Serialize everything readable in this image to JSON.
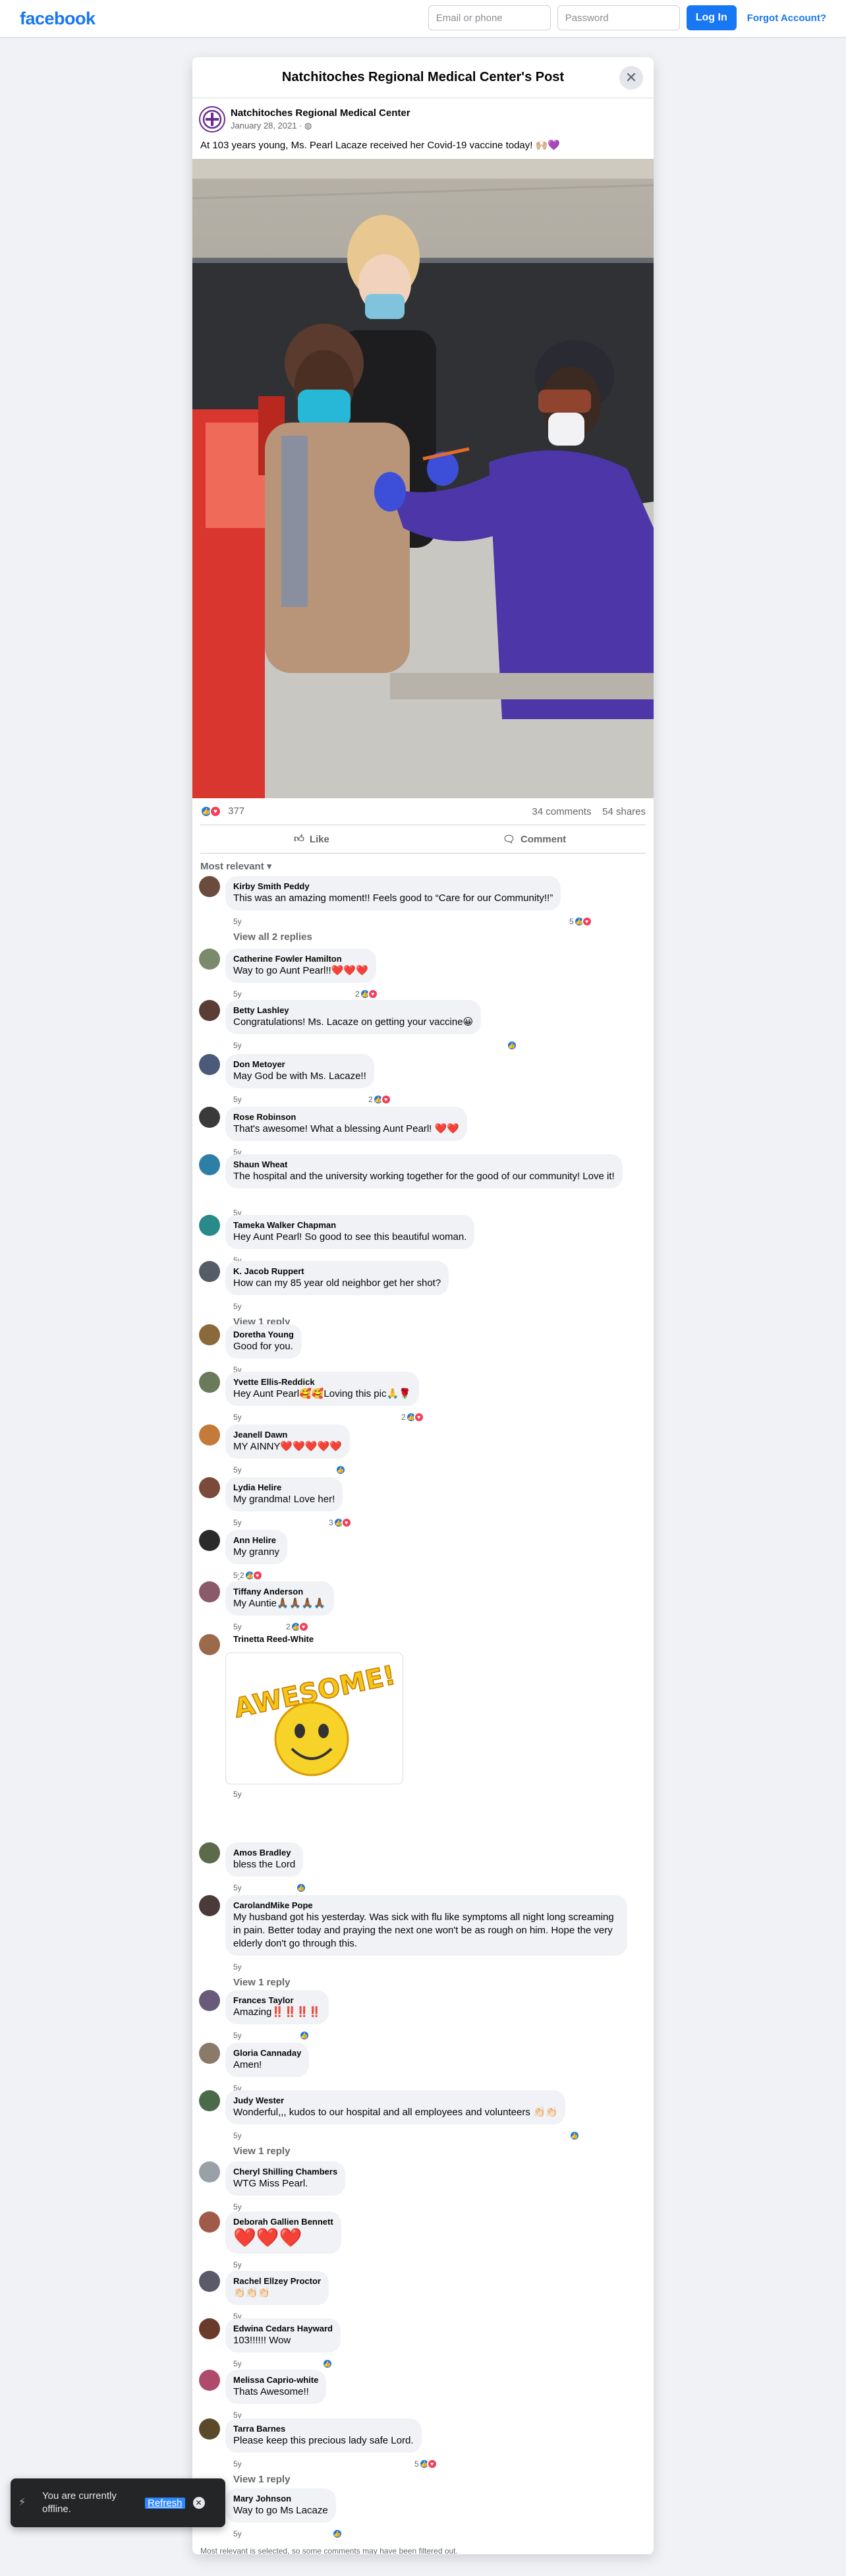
{
  "header": {
    "logo": "facebook",
    "email_placeholder": "Email or phone",
    "password_placeholder": "Password",
    "login_label": "Log In",
    "forgot_label": "Forgot Account?"
  },
  "modal": {
    "title": "Natchitoches Regional Medical Center's Post"
  },
  "post": {
    "page_name": "Natchitoches Regional Medical Center",
    "date": "January 28, 2021 · ",
    "text": "At 103 years young, Ms. Pearl Lacaze received her Covid-19 vaccine today! 🙌🏼💜",
    "reactions_count": "377",
    "comments_count": "34 comments",
    "shares_count": "54 shares"
  },
  "actions": {
    "like": "Like",
    "comment": "Comment"
  },
  "sort_label": "Most relevant",
  "comments": [
    {
      "name": "Kirby Smith Peddy",
      "text": "This was an amazing moment!! Feels good to “Care for our Community!!”",
      "time": "5y",
      "reactions": "5",
      "replies": "View all 2 replies",
      "avatar_color": "#6b4b3e"
    },
    {
      "name": "Catherine Fowler Hamilton",
      "text": "Way to go Aunt Pearl!!❤️❤️❤️",
      "time": "5y",
      "reactions": "2",
      "avatar_color": "#7a8a6a"
    },
    {
      "name": "Betty Lashley",
      "text": "Congratulations! Ms. Lacaze on getting your vaccine😀",
      "time": "5y",
      "reactions": "",
      "avatar_color": "#5a3e36"
    },
    {
      "name": "Don Metoyer",
      "text": "May God be with Ms. Lacaze!!",
      "time": "5y",
      "reactions": "2",
      "avatar_color": "#4a5a78"
    },
    {
      "name": "Rose Robinson",
      "text": "That's awesome! What a blessing Aunt Pearl! ❤️❤️",
      "time": "5y",
      "reactions": "",
      "avatar_color": "#3a3a3a"
    },
    {
      "name": "Shaun Wheat",
      "text": "The hospital and the university working together for the good of our community! Love it!",
      "time": "5y",
      "reactions": "",
      "avatar_color": "#2d7fa8"
    },
    {
      "name": "Tameka Walker Chapman",
      "text": "Hey Aunt Pearl! So good to see this beautiful woman.",
      "time": "5y",
      "reactions": "",
      "avatar_color": "#2a8a8a"
    },
    {
      "name": "K. Jacob Ruppert",
      "text": "How can my 85 year old neighbor get her shot?",
      "time": "5y",
      "reactions": "",
      "replies": "View 1 reply",
      "avatar_color": "#555c66"
    },
    {
      "name": "Doretha Young",
      "text": "Good for you.",
      "time": "5y",
      "reactions": "",
      "avatar_color": "#8a6a3a"
    },
    {
      "name": "Yvette Ellis-Reddick",
      "text": "Hey Aunt Pearl🥰🥰Loving this pic🙏🌹",
      "time": "5y",
      "reactions": "2",
      "avatar_color": "#6a7a5a"
    },
    {
      "name": "Jeanell Dawn",
      "text": "MY AINNY❤️❤️❤️❤️❤️",
      "time": "5y",
      "reactions": "",
      "avatar_color": "#c47a3a"
    },
    {
      "name": "Lydia Helire",
      "text": "My grandma! Love her!",
      "time": "5y",
      "reactions": "3",
      "avatar_color": "#7a4a3a"
    },
    {
      "name": "Ann Helire",
      "text": "My granny",
      "time": "5y",
      "reactions": "2",
      "avatar_color": "#2a2a2a"
    },
    {
      "name": "Tiffany Anderson",
      "text": "My Auntie🙏🏾🙏🏾🙏🏾🙏🏾",
      "time": "5y",
      "reactions": "2",
      "avatar_color": "#8a5a6a"
    },
    {
      "name": "Trinetta Reed-White",
      "text": "",
      "time": "5y",
      "reactions": "",
      "sticker": "AWESOME!",
      "avatar_color": "#9a6a4a"
    },
    {
      "name": "Amos Bradley",
      "text": "bless the Lord",
      "time": "5y",
      "reactions": "",
      "avatar_color": "#5a6a4a"
    },
    {
      "name": "CarolandMike Pope",
      "text": "My husband got his yesterday. Was sick with flu like symptoms all night long screaming in pain. Better today and praying the next one won't be as rough on him. Hope the very elderly don't go through this.",
      "time": "5y",
      "reactions": "",
      "replies": "View 1 reply",
      "avatar_color": "#4a3a3a"
    },
    {
      "name": "Frances Taylor",
      "text": "Amazing‼️‼️‼️‼️",
      "time": "5y",
      "reactions": "",
      "avatar_color": "#6a5a7a"
    },
    {
      "name": "Gloria Cannaday",
      "text": "Amen!",
      "time": "5y",
      "reactions": "",
      "avatar_color": "#8a7a6a"
    },
    {
      "name": "Judy Wester",
      "text": "Wonderful,,, kudos to our hospital and all employees and volunteers 👏🏻👏🏻",
      "time": "5y",
      "reactions": "",
      "replies": "View 1 reply",
      "avatar_color": "#4a6a4a"
    },
    {
      "name": "Cheryl Shilling Chambers",
      "text": "WTG Miss Pearl.",
      "time": "5y",
      "reactions": "",
      "avatar_color": "#9aa0a8"
    },
    {
      "name": "Deborah Gallien Bennett",
      "text": "❤️❤️❤️",
      "time": "5y",
      "reactions": "",
      "avatar_color": "#a05a4a"
    },
    {
      "name": "Rachel Ellzey Proctor",
      "text": "👏🏻👏🏻👏🏻",
      "time": "5y",
      "reactions": "",
      "avatar_color": "#5a5a6a"
    },
    {
      "name": "Edwina Cedars Hayward",
      "text": "103!!!!!! Wow",
      "time": "5y",
      "reactions": "",
      "avatar_color": "#6a3a2a"
    },
    {
      "name": "Melissa Caprio-white",
      "text": "Thats Awesome!!",
      "time": "5y",
      "reactions": "",
      "avatar_color": "#b04a6a"
    },
    {
      "name": "Tarra Barnes",
      "text": "Please keep this precious lady safe Lord.",
      "time": "5y",
      "reactions": "5",
      "replies": "View 1 reply",
      "avatar_color": "#5a4a2a"
    },
    {
      "name": "Mary Johnson",
      "text": "Way to go Ms Lacaze",
      "time": "5y",
      "reactions": "",
      "avatar_color": "#3a4a6a"
    }
  ],
  "footnote": "Most relevant is selected, so some comments may have been filtered out.",
  "toast": {
    "text": "You are currently offline.",
    "refresh": "Refresh"
  },
  "colors": {
    "brand": "#1877f2",
    "like": "#1877f2",
    "love": "#f33e58"
  }
}
